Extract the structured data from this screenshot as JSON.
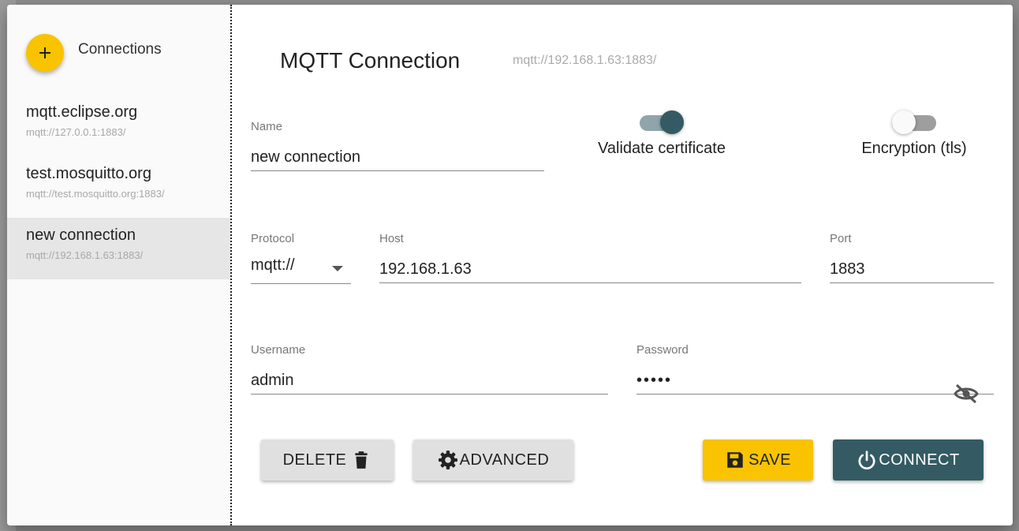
{
  "sidebar": {
    "add_icon": "plus-icon",
    "title": "Connections",
    "connections": [
      {
        "name": "mqtt.eclipse.org",
        "url": "mqtt://127.0.0.1:1883/"
      },
      {
        "name": "test.mosquitto.org",
        "url": "mqtt://test.mosquitto.org:1883/"
      },
      {
        "name": "new connection",
        "url": "mqtt://192.168.1.63:1883/",
        "selected": true
      }
    ]
  },
  "main": {
    "title": "MQTT Connection",
    "url": "mqtt://192.168.1.63:1883/",
    "name_field": {
      "label": "Name",
      "value": "new connection"
    },
    "validate_certificate": {
      "label": "Validate certificate",
      "on": true
    },
    "encryption": {
      "label": "Encryption (tls)",
      "on": false
    },
    "protocol": {
      "label": "Protocol",
      "value": "mqtt://"
    },
    "host": {
      "label": "Host",
      "value": "192.168.1.63"
    },
    "port": {
      "label": "Port",
      "value": "1883"
    },
    "username": {
      "label": "Username",
      "value": "admin"
    },
    "password": {
      "label": "Password",
      "value": "•••••",
      "visibility_icon": "eye-off-icon"
    }
  },
  "actions": {
    "delete_label": "DELETE",
    "advanced_label": "ADVANCED",
    "save_label": "SAVE",
    "connect_label": "CONNECT"
  },
  "colors": {
    "accent_yellow": "#f9c300",
    "primary_dark": "#345b63",
    "switch_track_on": "#8fa5a9",
    "switch_track_off": "#9e9e9e",
    "selected_item_bg": "#e6e6e6"
  }
}
